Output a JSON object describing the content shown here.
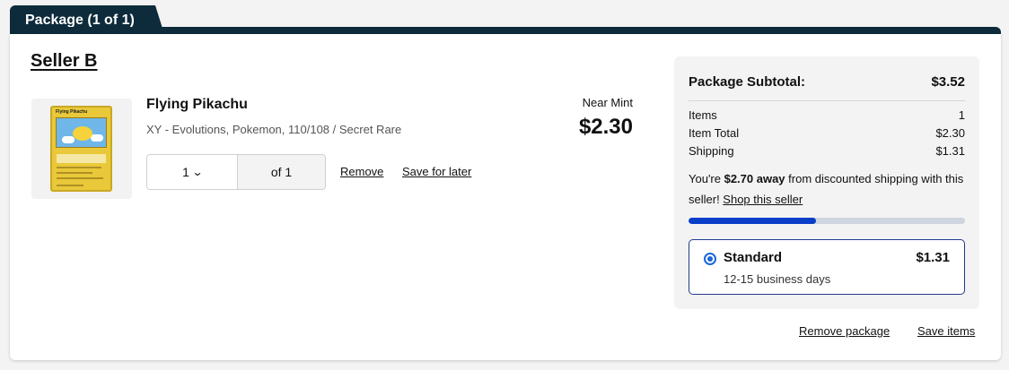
{
  "package": {
    "tab_label": "Package (1 of 1)"
  },
  "seller": {
    "name": "Seller B"
  },
  "item": {
    "title": "Flying Pikachu",
    "subtitle": "XY - Evolutions, Pokemon, 110/108 / Secret Rare",
    "condition": "Near Mint",
    "price": "$2.30",
    "quantity": "1",
    "quantity_of": "of 1",
    "remove_label": "Remove",
    "save_for_later_label": "Save for later",
    "image_card_name": "Flying Pikachu"
  },
  "summary": {
    "subtitle_label": "Package Subtotal:",
    "subtitle_value": "$3.52",
    "rows": [
      {
        "label": "Items",
        "value": "1"
      },
      {
        "label": "Item Total",
        "value": "$2.30"
      },
      {
        "label": "Shipping",
        "value": "$1.31"
      }
    ],
    "ship_msg_prefix": "You're ",
    "ship_msg_amount": "$2.70 away",
    "ship_msg_mid": " from discounted shipping with this seller! ",
    "ship_msg_link": "Shop this seller",
    "progress_fraction": 0.46,
    "shipping_option": {
      "name": "Standard",
      "price": "$1.31",
      "days": "12-15 business days",
      "selected": true
    }
  },
  "footer": {
    "remove_package_label": "Remove package",
    "save_items_label": "Save items"
  },
  "colors": {
    "header_bg": "#0d2b3b",
    "progress_fill": "#0a3ec9",
    "radio_accent": "#1b65d8"
  }
}
